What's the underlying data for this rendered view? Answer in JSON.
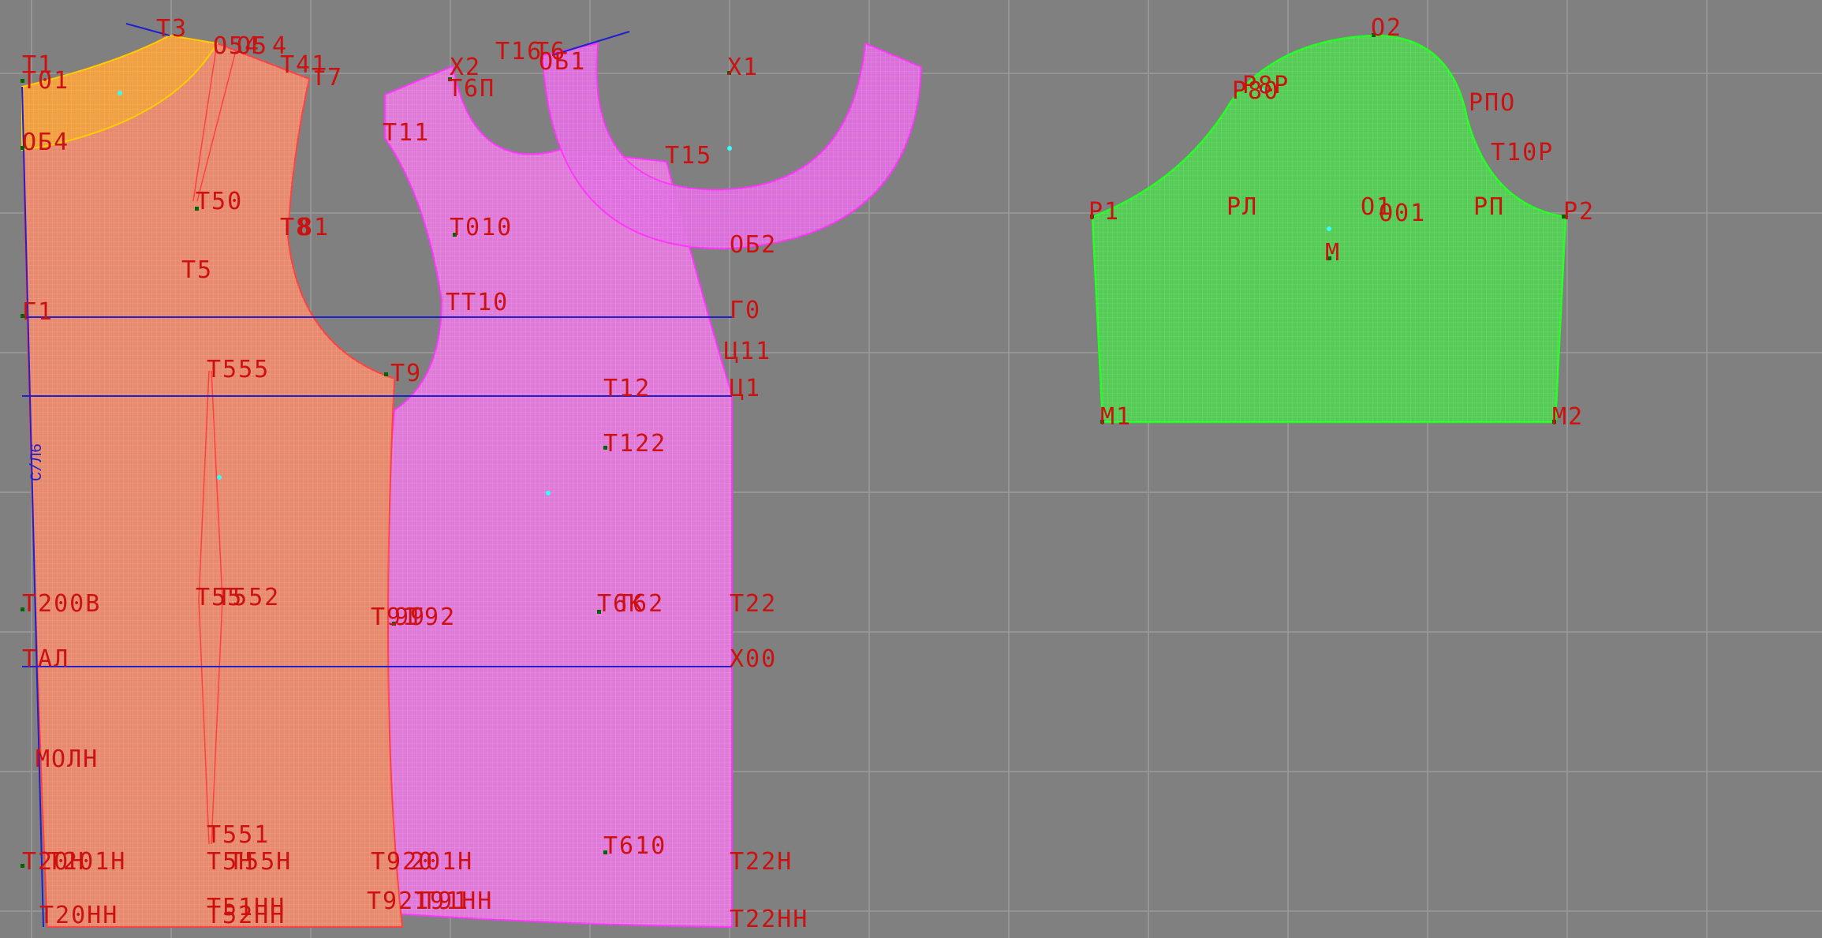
{
  "colors": {
    "background": "#808080",
    "grid": "#9a9a9a",
    "back_piece_fill": "#e88a6e",
    "back_piece_stroke": "#ff4040",
    "front_piece_fill": "#e07ad8",
    "front_piece_stroke": "#ff33ff",
    "yoke_fill": "#f0a040",
    "neck_facing_fill": "#e070e0",
    "sleeve_fill": "#55cc55",
    "sleeve_stroke": "#22ff22",
    "construction_line": "#2020cc",
    "label": "#cc1111",
    "point": "#006600",
    "marker": "#33ffff"
  },
  "back_labels": {
    "t1": "T1",
    "t01": "T01",
    "t3": "T3",
    "o54": "O54",
    "o5": "O5",
    "t4": "4",
    "t41": "T41",
    "t7": "T7",
    "ob4": "OБ4",
    "t50": "T50",
    "t8": "T8",
    "t81": "81",
    "t5": "T5",
    "g1": "Г1",
    "t555": "T555",
    "t9": "T9",
    "t200b": "T200B",
    "t55": "T55",
    "t552": "T552",
    "t91": "T91",
    "t99": "99",
    "t92": "T92",
    "tal": "TAЛ",
    "moln": "MOЛH",
    "t551": "T551",
    "t20n": "T20H",
    "t201n": "T201H",
    "t5n": "T5H",
    "t55n": "T55H",
    "t920": "T920",
    "t20nn": "T20HH",
    "t51nn": "T51HH",
    "t52nn": "T52HH",
    "t921nn": "T921",
    "t91nn": "T91HH",
    "fold": "C/Л6"
  },
  "front_labels": {
    "h2": "X2",
    "t6p": "T6П",
    "t16": "T16",
    "t6": "T6",
    "ob1": "OБ1",
    "h1": "X1",
    "t11": "T11",
    "t15": "T15",
    "t010": "T010",
    "ob2": "OБ2",
    "tt10": "TT10",
    "g0": "Г0",
    "c11": "Ц11",
    "t12": "T12",
    "c1": "Ц1",
    "t122": "T122",
    "t6k": "T6K",
    "t62": "T62",
    "t22": "T22",
    "h00": "X00",
    "t610": "T610",
    "t22n": "T22H",
    "t22nn": "T22HH",
    "t201h": "201H",
    "t91n": "T91"
  },
  "sleeve_labels": {
    "o2": "O2",
    "p80": "P80",
    "p8p": "P8P",
    "rpo": "РПО",
    "t10r": "T10P",
    "r1": "P1",
    "rl": "PЛ",
    "o1": "O1",
    "o01": "O01",
    "rp": "PП",
    "r2": "P2",
    "m": "M",
    "m1": "M1",
    "m2": "M2"
  }
}
